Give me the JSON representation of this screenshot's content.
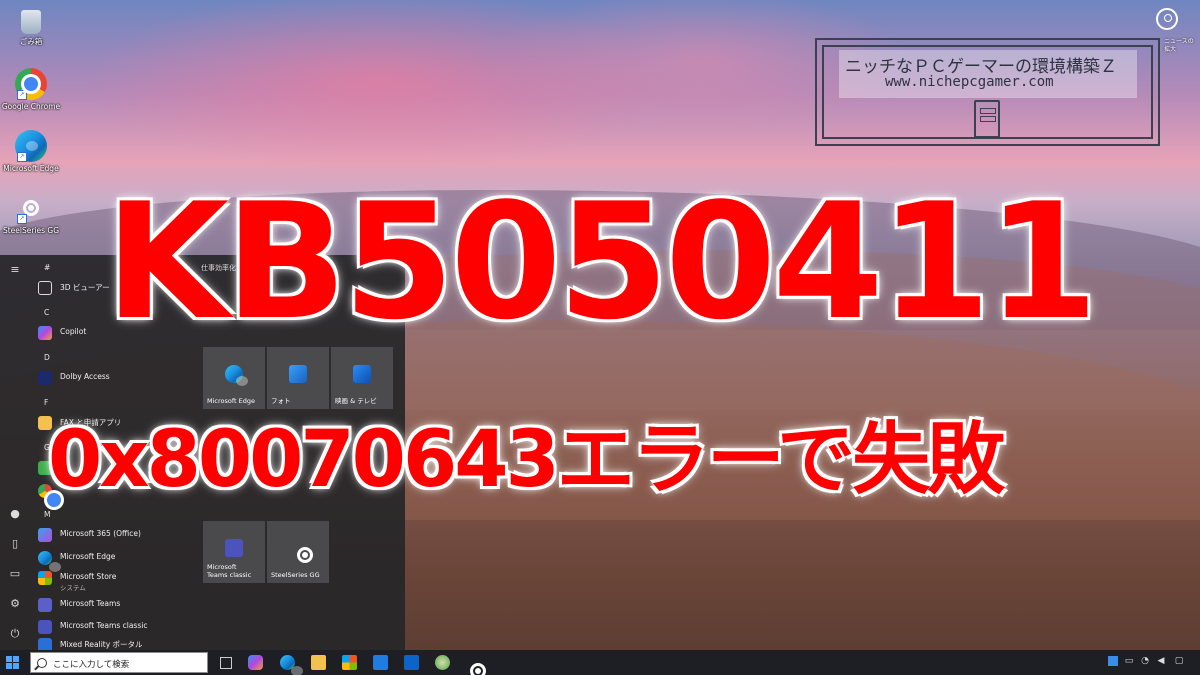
{
  "desktop_icons": [
    {
      "label": "ごみ箱",
      "icon": "recycle-bin-icon"
    },
    {
      "label": "Google Chrome",
      "icon": "chrome-icon"
    },
    {
      "label": "Microsoft Edge",
      "icon": "edge-icon"
    },
    {
      "label": "SteelSeries GG",
      "icon": "steelseries-icon"
    }
  ],
  "logo": {
    "title": "ニッチなＰＣゲーマーの環境構築Ｚ",
    "url": "www.nichepcgamer.com"
  },
  "headline": {
    "kb": "KB5050411",
    "error": "0x80070643エラーで失敗"
  },
  "widget": {
    "label": "ニュースの\n拡大"
  },
  "start_menu": {
    "letters": {
      "hash": "#",
      "c": "C",
      "d": "D",
      "f": "F",
      "g": "G",
      "m": "M"
    },
    "apps": [
      {
        "name": "3D ビューアー"
      },
      {
        "name": "Copilot"
      },
      {
        "name": "Dolby Access"
      },
      {
        "name": "FAX と申請アプリ"
      },
      {
        "name": "Microsoft 365 (Office)"
      },
      {
        "name": "Microsoft Edge"
      },
      {
        "name": "Microsoft Store",
        "sub": "システム"
      },
      {
        "name": "Microsoft Teams"
      },
      {
        "name": "Microsoft Teams classic"
      },
      {
        "name": "Mixed Reality ポータル"
      }
    ],
    "tile_group": "仕事効率化",
    "tiles": [
      {
        "label": "Microsoft Edge"
      },
      {
        "label": "フォト"
      },
      {
        "label": "映画 & テレビ"
      },
      {
        "label": "Microsoft\nTeams classic"
      },
      {
        "label": "SteelSeries GG"
      }
    ]
  },
  "taskbar": {
    "search_placeholder": "ここに入力して検索",
    "pinned": [
      "task-view-icon",
      "copilot-icon",
      "edge-icon",
      "file-explorer-icon",
      "store-icon",
      "mail-icon",
      "outlook-icon",
      "photos-icon",
      "steelseries-icon"
    ]
  },
  "colors": {
    "headline": "#ff0000",
    "taskbar": "#1e1f24",
    "start_menu": "#262628"
  }
}
